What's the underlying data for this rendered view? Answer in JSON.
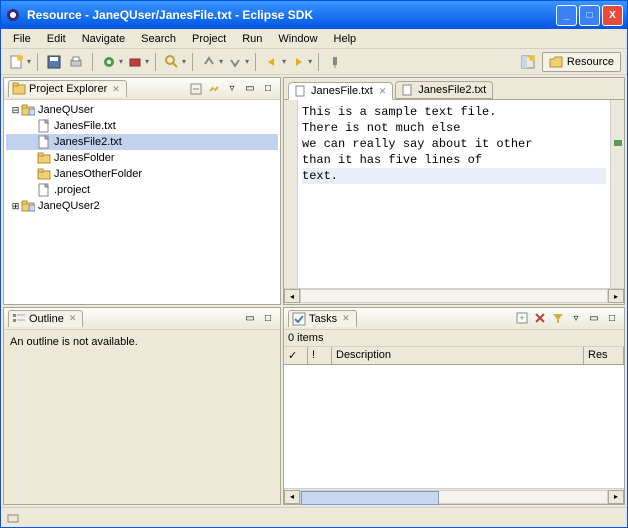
{
  "titlebar": {
    "text": "Resource - JaneQUser/JanesFile.txt - Eclipse SDK"
  },
  "menu": [
    "File",
    "Edit",
    "Navigate",
    "Search",
    "Project",
    "Run",
    "Window",
    "Help"
  ],
  "perspective": {
    "label": "Resource"
  },
  "projectExplorer": {
    "title": "Project Explorer",
    "tree": [
      {
        "level": 0,
        "expand": "-",
        "icon": "project",
        "label": "JaneQUser"
      },
      {
        "level": 1,
        "expand": "",
        "icon": "file",
        "label": "JanesFile.txt"
      },
      {
        "level": 1,
        "expand": "",
        "icon": "file",
        "label": "JanesFile2.txt",
        "sel": true
      },
      {
        "level": 1,
        "expand": "",
        "icon": "folder",
        "label": "JanesFolder"
      },
      {
        "level": 1,
        "expand": "",
        "icon": "folder",
        "label": "JanesOtherFolder"
      },
      {
        "level": 1,
        "expand": "",
        "icon": "file",
        "label": ".project"
      },
      {
        "level": 0,
        "expand": "+",
        "icon": "project",
        "label": "JaneQUser2"
      }
    ]
  },
  "outline": {
    "title": "Outline",
    "message": "An outline is not available."
  },
  "editor": {
    "tabs": [
      {
        "label": "JanesFile.txt",
        "active": true
      },
      {
        "label": "JanesFile2.txt",
        "active": false
      }
    ],
    "lines": [
      "This is a sample text file.",
      "There is not much else",
      "we can really say about it other",
      "than it has five lines of",
      "text."
    ],
    "currentLine": 4
  },
  "tasks": {
    "title": "Tasks",
    "info": "0 items",
    "columns": [
      "✓",
      "!",
      "Description",
      "Res"
    ]
  }
}
